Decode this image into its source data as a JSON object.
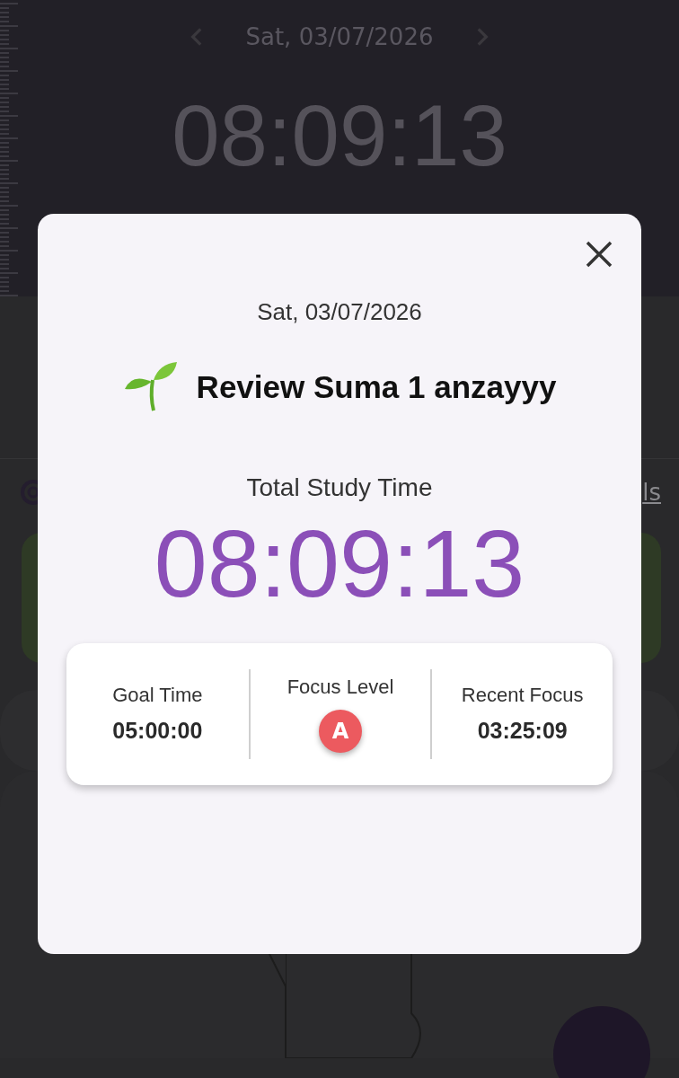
{
  "background": {
    "date": "Sat, 03/07/2026",
    "timer": "08:09:13",
    "link_text": "ls"
  },
  "dialog": {
    "date": "Sat, 03/07/2026",
    "subject": "Review Suma 1 anzayyy",
    "total_label": "Total Study Time",
    "total_time": "08:09:13",
    "stats": [
      {
        "kind": "text",
        "label": "Goal Time",
        "value": "05:00:00"
      },
      {
        "kind": "grade",
        "label": "Focus Level",
        "value": "A",
        "color": "#ec5a5f"
      },
      {
        "kind": "text",
        "label": "Recent Focus",
        "value": "03:25:09"
      }
    ]
  }
}
